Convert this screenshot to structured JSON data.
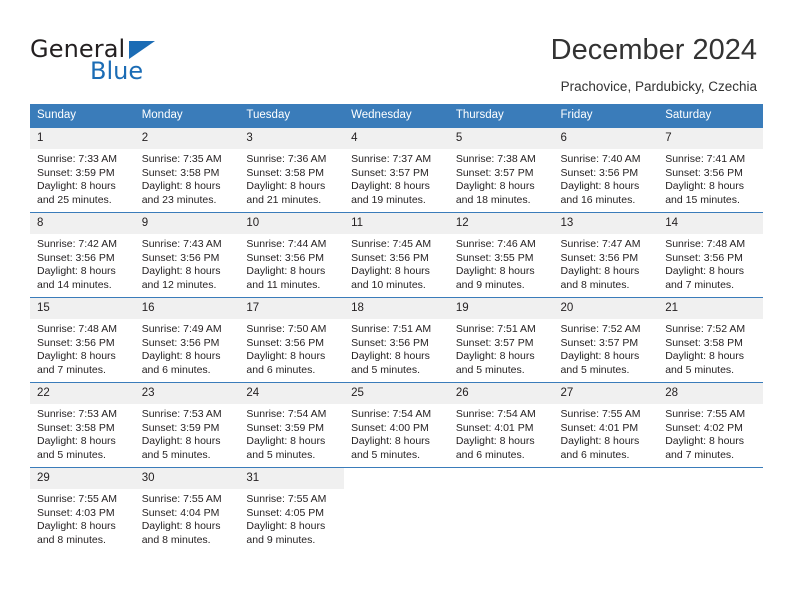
{
  "brand": {
    "name_part1": "General",
    "name_part2": "Blue",
    "accent_color": "#1b6cb5"
  },
  "header": {
    "title": "December 2024",
    "subtitle": "Prachovice, Pardubicky, Czechia"
  },
  "calendar": {
    "header_bg": "#3a7cba",
    "daynum_bg": "#f0f0f0",
    "weekday_headers": [
      "Sunday",
      "Monday",
      "Tuesday",
      "Wednesday",
      "Thursday",
      "Friday",
      "Saturday"
    ],
    "weeks": [
      [
        {
          "day": "1",
          "sunrise": "Sunrise: 7:33 AM",
          "sunset": "Sunset: 3:59 PM",
          "daylight_line1": "Daylight: 8 hours",
          "daylight_line2": "and 25 minutes."
        },
        {
          "day": "2",
          "sunrise": "Sunrise: 7:35 AM",
          "sunset": "Sunset: 3:58 PM",
          "daylight_line1": "Daylight: 8 hours",
          "daylight_line2": "and 23 minutes."
        },
        {
          "day": "3",
          "sunrise": "Sunrise: 7:36 AM",
          "sunset": "Sunset: 3:58 PM",
          "daylight_line1": "Daylight: 8 hours",
          "daylight_line2": "and 21 minutes."
        },
        {
          "day": "4",
          "sunrise": "Sunrise: 7:37 AM",
          "sunset": "Sunset: 3:57 PM",
          "daylight_line1": "Daylight: 8 hours",
          "daylight_line2": "and 19 minutes."
        },
        {
          "day": "5",
          "sunrise": "Sunrise: 7:38 AM",
          "sunset": "Sunset: 3:57 PM",
          "daylight_line1": "Daylight: 8 hours",
          "daylight_line2": "and 18 minutes."
        },
        {
          "day": "6",
          "sunrise": "Sunrise: 7:40 AM",
          "sunset": "Sunset: 3:56 PM",
          "daylight_line1": "Daylight: 8 hours",
          "daylight_line2": "and 16 minutes."
        },
        {
          "day": "7",
          "sunrise": "Sunrise: 7:41 AM",
          "sunset": "Sunset: 3:56 PM",
          "daylight_line1": "Daylight: 8 hours",
          "daylight_line2": "and 15 minutes."
        }
      ],
      [
        {
          "day": "8",
          "sunrise": "Sunrise: 7:42 AM",
          "sunset": "Sunset: 3:56 PM",
          "daylight_line1": "Daylight: 8 hours",
          "daylight_line2": "and 14 minutes."
        },
        {
          "day": "9",
          "sunrise": "Sunrise: 7:43 AM",
          "sunset": "Sunset: 3:56 PM",
          "daylight_line1": "Daylight: 8 hours",
          "daylight_line2": "and 12 minutes."
        },
        {
          "day": "10",
          "sunrise": "Sunrise: 7:44 AM",
          "sunset": "Sunset: 3:56 PM",
          "daylight_line1": "Daylight: 8 hours",
          "daylight_line2": "and 11 minutes."
        },
        {
          "day": "11",
          "sunrise": "Sunrise: 7:45 AM",
          "sunset": "Sunset: 3:56 PM",
          "daylight_line1": "Daylight: 8 hours",
          "daylight_line2": "and 10 minutes."
        },
        {
          "day": "12",
          "sunrise": "Sunrise: 7:46 AM",
          "sunset": "Sunset: 3:55 PM",
          "daylight_line1": "Daylight: 8 hours",
          "daylight_line2": "and 9 minutes."
        },
        {
          "day": "13",
          "sunrise": "Sunrise: 7:47 AM",
          "sunset": "Sunset: 3:56 PM",
          "daylight_line1": "Daylight: 8 hours",
          "daylight_line2": "and 8 minutes."
        },
        {
          "day": "14",
          "sunrise": "Sunrise: 7:48 AM",
          "sunset": "Sunset: 3:56 PM",
          "daylight_line1": "Daylight: 8 hours",
          "daylight_line2": "and 7 minutes."
        }
      ],
      [
        {
          "day": "15",
          "sunrise": "Sunrise: 7:48 AM",
          "sunset": "Sunset: 3:56 PM",
          "daylight_line1": "Daylight: 8 hours",
          "daylight_line2": "and 7 minutes."
        },
        {
          "day": "16",
          "sunrise": "Sunrise: 7:49 AM",
          "sunset": "Sunset: 3:56 PM",
          "daylight_line1": "Daylight: 8 hours",
          "daylight_line2": "and 6 minutes."
        },
        {
          "day": "17",
          "sunrise": "Sunrise: 7:50 AM",
          "sunset": "Sunset: 3:56 PM",
          "daylight_line1": "Daylight: 8 hours",
          "daylight_line2": "and 6 minutes."
        },
        {
          "day": "18",
          "sunrise": "Sunrise: 7:51 AM",
          "sunset": "Sunset: 3:56 PM",
          "daylight_line1": "Daylight: 8 hours",
          "daylight_line2": "and 5 minutes."
        },
        {
          "day": "19",
          "sunrise": "Sunrise: 7:51 AM",
          "sunset": "Sunset: 3:57 PM",
          "daylight_line1": "Daylight: 8 hours",
          "daylight_line2": "and 5 minutes."
        },
        {
          "day": "20",
          "sunrise": "Sunrise: 7:52 AM",
          "sunset": "Sunset: 3:57 PM",
          "daylight_line1": "Daylight: 8 hours",
          "daylight_line2": "and 5 minutes."
        },
        {
          "day": "21",
          "sunrise": "Sunrise: 7:52 AM",
          "sunset": "Sunset: 3:58 PM",
          "daylight_line1": "Daylight: 8 hours",
          "daylight_line2": "and 5 minutes."
        }
      ],
      [
        {
          "day": "22",
          "sunrise": "Sunrise: 7:53 AM",
          "sunset": "Sunset: 3:58 PM",
          "daylight_line1": "Daylight: 8 hours",
          "daylight_line2": "and 5 minutes."
        },
        {
          "day": "23",
          "sunrise": "Sunrise: 7:53 AM",
          "sunset": "Sunset: 3:59 PM",
          "daylight_line1": "Daylight: 8 hours",
          "daylight_line2": "and 5 minutes."
        },
        {
          "day": "24",
          "sunrise": "Sunrise: 7:54 AM",
          "sunset": "Sunset: 3:59 PM",
          "daylight_line1": "Daylight: 8 hours",
          "daylight_line2": "and 5 minutes."
        },
        {
          "day": "25",
          "sunrise": "Sunrise: 7:54 AM",
          "sunset": "Sunset: 4:00 PM",
          "daylight_line1": "Daylight: 8 hours",
          "daylight_line2": "and 5 minutes."
        },
        {
          "day": "26",
          "sunrise": "Sunrise: 7:54 AM",
          "sunset": "Sunset: 4:01 PM",
          "daylight_line1": "Daylight: 8 hours",
          "daylight_line2": "and 6 minutes."
        },
        {
          "day": "27",
          "sunrise": "Sunrise: 7:55 AM",
          "sunset": "Sunset: 4:01 PM",
          "daylight_line1": "Daylight: 8 hours",
          "daylight_line2": "and 6 minutes."
        },
        {
          "day": "28",
          "sunrise": "Sunrise: 7:55 AM",
          "sunset": "Sunset: 4:02 PM",
          "daylight_line1": "Daylight: 8 hours",
          "daylight_line2": "and 7 minutes."
        }
      ],
      [
        {
          "day": "29",
          "sunrise": "Sunrise: 7:55 AM",
          "sunset": "Sunset: 4:03 PM",
          "daylight_line1": "Daylight: 8 hours",
          "daylight_line2": "and 8 minutes."
        },
        {
          "day": "30",
          "sunrise": "Sunrise: 7:55 AM",
          "sunset": "Sunset: 4:04 PM",
          "daylight_line1": "Daylight: 8 hours",
          "daylight_line2": "and 8 minutes."
        },
        {
          "day": "31",
          "sunrise": "Sunrise: 7:55 AM",
          "sunset": "Sunset: 4:05 PM",
          "daylight_line1": "Daylight: 8 hours",
          "daylight_line2": "and 9 minutes."
        },
        {
          "day": "",
          "sunrise": "",
          "sunset": "",
          "daylight_line1": "",
          "daylight_line2": ""
        },
        {
          "day": "",
          "sunrise": "",
          "sunset": "",
          "daylight_line1": "",
          "daylight_line2": ""
        },
        {
          "day": "",
          "sunrise": "",
          "sunset": "",
          "daylight_line1": "",
          "daylight_line2": ""
        },
        {
          "day": "",
          "sunrise": "",
          "sunset": "",
          "daylight_line1": "",
          "daylight_line2": ""
        }
      ]
    ]
  }
}
